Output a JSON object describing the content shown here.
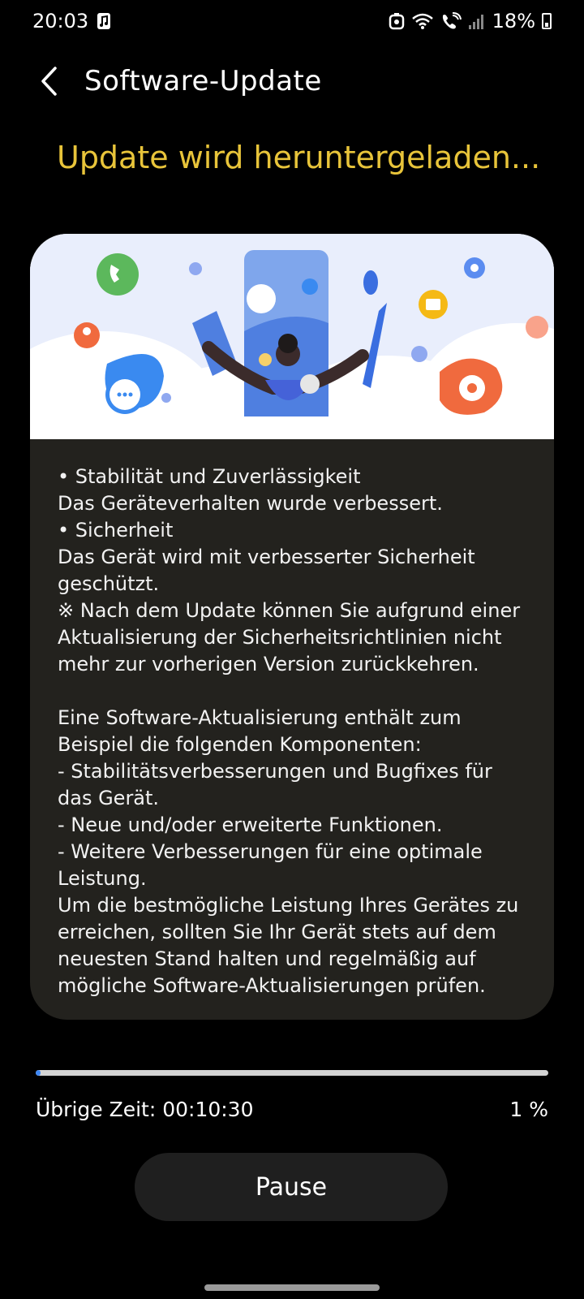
{
  "status_bar": {
    "time": "20:03",
    "battery": "18%",
    "icons": [
      "music-icon",
      "data-saver-icon",
      "wifi-icon",
      "wifi-calling-icon",
      "signal-icon",
      "battery-icon"
    ]
  },
  "header": {
    "title": "Software-Update",
    "back_icon": "chevron-left-icon"
  },
  "status_title": "Update wird heruntergeladen...",
  "release_notes": "• Stabilität und Zuverlässigkeit\nDas Geräteverhalten wurde verbessert.\n• Sicherheit\nDas Gerät wird mit verbesserter Sicherheit geschützt.\n※ Nach dem Update können Sie aufgrund einer Aktualisierung der Sicherheitsrichtlinien nicht mehr zur vorherigen Version zurückkehren.\n\nEine Software-Aktualisierung enthält zum Beispiel die folgenden Komponenten:\n - Stabilitätsverbesserungen und Bugfixes für das Gerät.\n - Neue und/oder erweiterte Funktionen.\n - Weitere Verbesserungen für eine optimale Leistung.\nUm die bestmögliche Leistung Ihres Gerätes zu erreichen, sollten Sie Ihr Gerät stets auf dem neuesten Stand halten und regelmäßig auf mögliche Software-Aktualisierungen prüfen.",
  "progress": {
    "percent": 1,
    "percent_label": "1 %",
    "remaining_label": "Übrige Zeit: 00:10:30"
  },
  "pause_button": "Pause",
  "colors": {
    "accent_title": "#e8c43a",
    "progress_fill": "#3e87f5",
    "progress_track": "#d4d4d4",
    "card_bg": "#23221e"
  }
}
